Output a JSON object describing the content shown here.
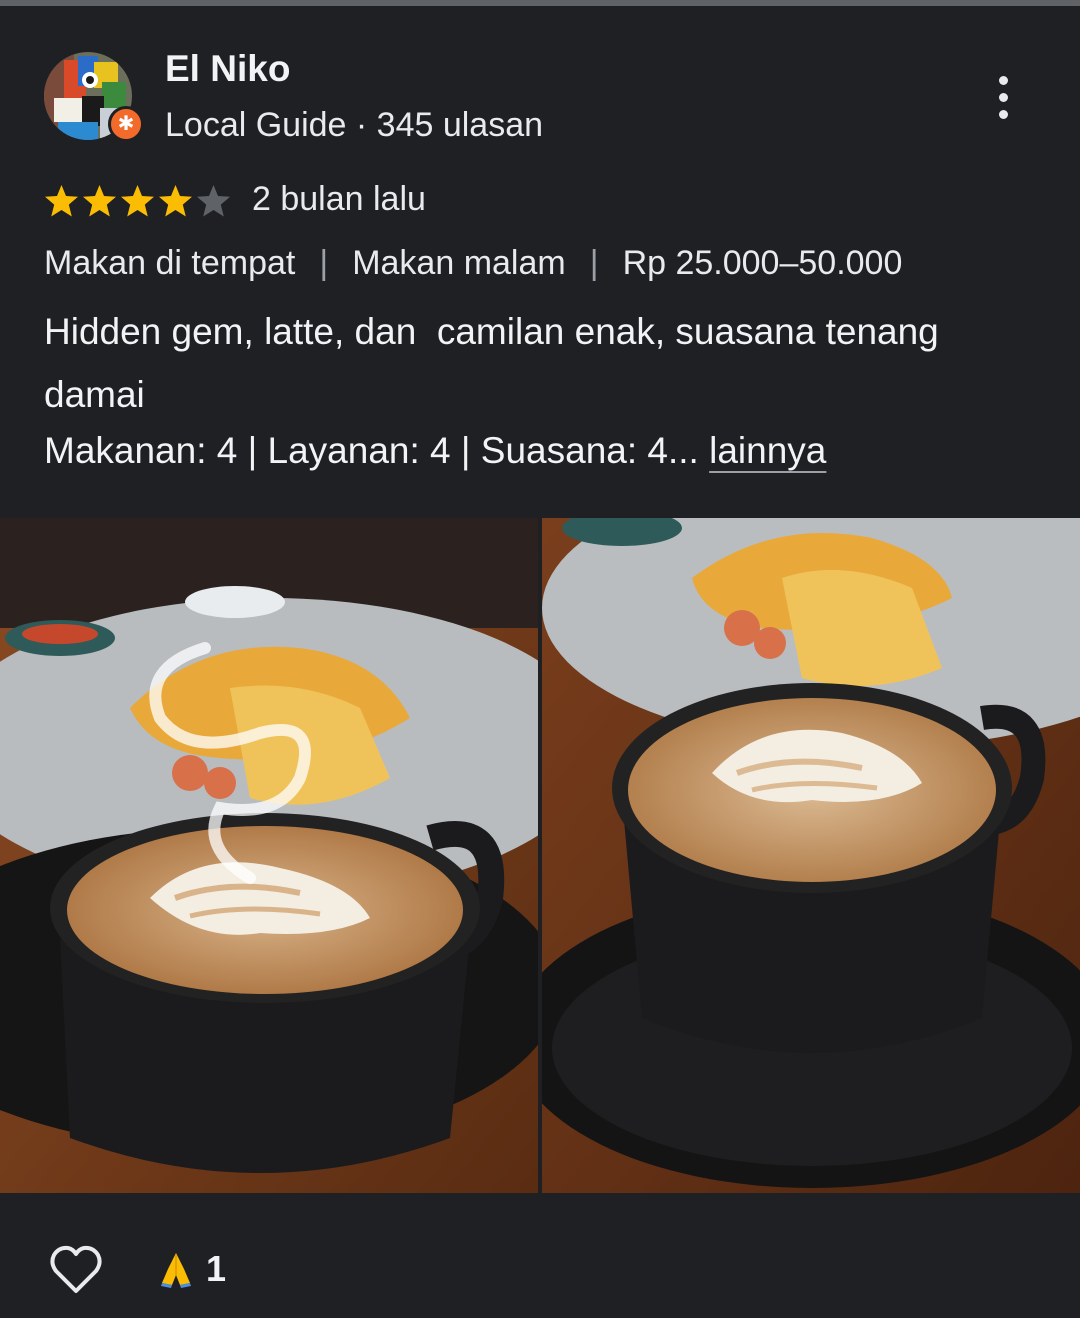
{
  "reviewer": {
    "name": "El Niko",
    "meta": "Local Guide · 345 ulasan"
  },
  "rating": {
    "stars": 4,
    "max_stars": 5,
    "date": "2 bulan lalu"
  },
  "tags": [
    "Makan di tempat",
    "Makan malam",
    "Rp 25.000–50.000"
  ],
  "review": {
    "text": "Hidden gem, latte, dan  camilan enak, suasana tenang damai",
    "scores": "Makanan: 4 | Layanan: 4 | Suasana: 4...",
    "more_label": "lainnya"
  },
  "reactions": {
    "count": "1",
    "emoji": "🙏"
  },
  "colors": {
    "background": "#1f2023",
    "star_filled": "#fbbc04",
    "star_empty": "#5f6368",
    "badge": "#f26b2a"
  },
  "icons": [
    "avatar",
    "local-guide-badge-icon",
    "more-vert-icon",
    "star-icon",
    "heart-outline-icon",
    "folded-hands-icon"
  ]
}
